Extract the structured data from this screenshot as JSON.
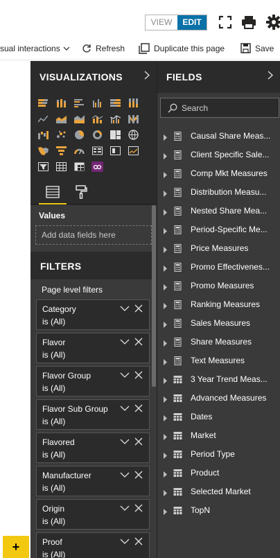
{
  "header": {
    "view_label": "VIEW",
    "edit_label": "EDIT",
    "icons": [
      "fullscreen-icon",
      "print-icon",
      "settings-icon"
    ]
  },
  "command_bar": {
    "visual_interactions": "sual interactions",
    "refresh": "Refresh",
    "duplicate_page": "Duplicate this page",
    "save": "Save"
  },
  "canvas": {
    "add_page": "+"
  },
  "visualizations": {
    "title": "VISUALIZATIONS",
    "values_title": "Values",
    "values_placeholder": "Add data fields here",
    "filters_title": "FILTERS",
    "page_filters_label": "Page level filters",
    "filters": [
      {
        "name": "Category",
        "value": "is (All)"
      },
      {
        "name": "Flavor",
        "value": "is (All)"
      },
      {
        "name": "Flavor Group",
        "value": "is (All)"
      },
      {
        "name": "Flavor Sub Group",
        "value": "is (All)"
      },
      {
        "name": "Flavored",
        "value": "is (All)"
      },
      {
        "name": "Manufacturer",
        "value": "is (All)"
      },
      {
        "name": "Origin",
        "value": "is (All)"
      },
      {
        "name": "Proof",
        "value": "is (All)"
      }
    ]
  },
  "fields": {
    "title": "FIELDS",
    "search_placeholder": "Search",
    "items": [
      {
        "label": "Causal Share Meas...",
        "kind": "measure-table"
      },
      {
        "label": "Client Specific Sale...",
        "kind": "measure-table"
      },
      {
        "label": "Comp Mkt Measures",
        "kind": "measure-table"
      },
      {
        "label": "Distribution Measu...",
        "kind": "measure-table"
      },
      {
        "label": "Nested Share Mea...",
        "kind": "measure-table"
      },
      {
        "label": "Period-Specific Me...",
        "kind": "measure-table"
      },
      {
        "label": "Price Measures",
        "kind": "measure-table"
      },
      {
        "label": "Promo Effectivenes...",
        "kind": "measure-table"
      },
      {
        "label": "Promo Measures",
        "kind": "measure-table"
      },
      {
        "label": "Ranking Measures",
        "kind": "measure-table"
      },
      {
        "label": "Sales Measures",
        "kind": "measure-table"
      },
      {
        "label": "Share Measures",
        "kind": "measure-table"
      },
      {
        "label": "Text Measures",
        "kind": "measure-table"
      },
      {
        "label": "3 Year Trend Meas...",
        "kind": "table"
      },
      {
        "label": "Advanced Measures",
        "kind": "table"
      },
      {
        "label": "Dates",
        "kind": "table"
      },
      {
        "label": "Market",
        "kind": "table"
      },
      {
        "label": "Period Type",
        "kind": "table"
      },
      {
        "label": "Product",
        "kind": "table"
      },
      {
        "label": "Selected Market",
        "kind": "table"
      },
      {
        "label": "TopN",
        "kind": "table"
      }
    ]
  },
  "colors": {
    "accent_yellow": "#f2c811",
    "edit_blue": "#0a72a8",
    "pane_dark": "#2b2b2b",
    "pane_mid": "#3a3a3a"
  }
}
